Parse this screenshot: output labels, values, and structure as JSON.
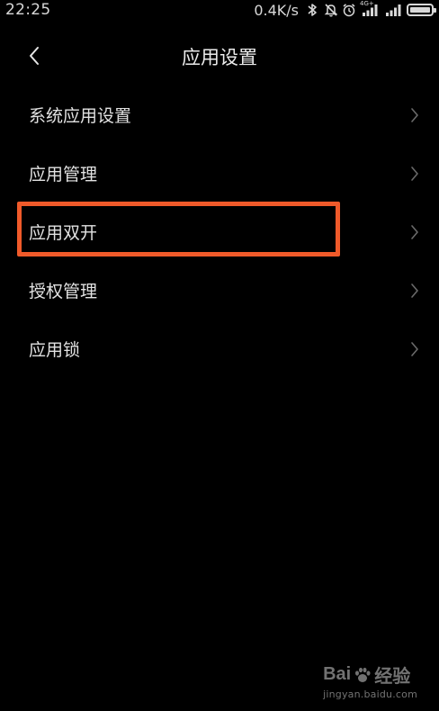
{
  "status_bar": {
    "time": "22:25",
    "net_speed": "0.4K/s",
    "signal_tag": "4G+",
    "icons": [
      "bluetooth-icon",
      "mute-icon",
      "alarm-icon",
      "signal-4g-icon",
      "signal-icon",
      "battery-icon"
    ],
    "battery_level": 1.0
  },
  "header": {
    "title": "应用设置",
    "back_icon": "chevron-left-icon"
  },
  "menu": {
    "items": [
      {
        "label": "系统应用设置"
      },
      {
        "label": "应用管理"
      },
      {
        "label": "应用双开"
      },
      {
        "label": "授权管理"
      },
      {
        "label": "应用锁"
      }
    ],
    "chevron_icon": "chevron-right-icon"
  },
  "annotation": {
    "highlighted_item": "应用双开",
    "color": "#f05a2a"
  },
  "watermark": {
    "logo_text_left": "Bai",
    "logo_text_right": "经验",
    "url": "jingyan.baidu.com"
  },
  "colors": {
    "background": "#000000",
    "text": "#e2e2e2",
    "chevron": "#6a6a6a",
    "highlight": "#f05a2a"
  }
}
